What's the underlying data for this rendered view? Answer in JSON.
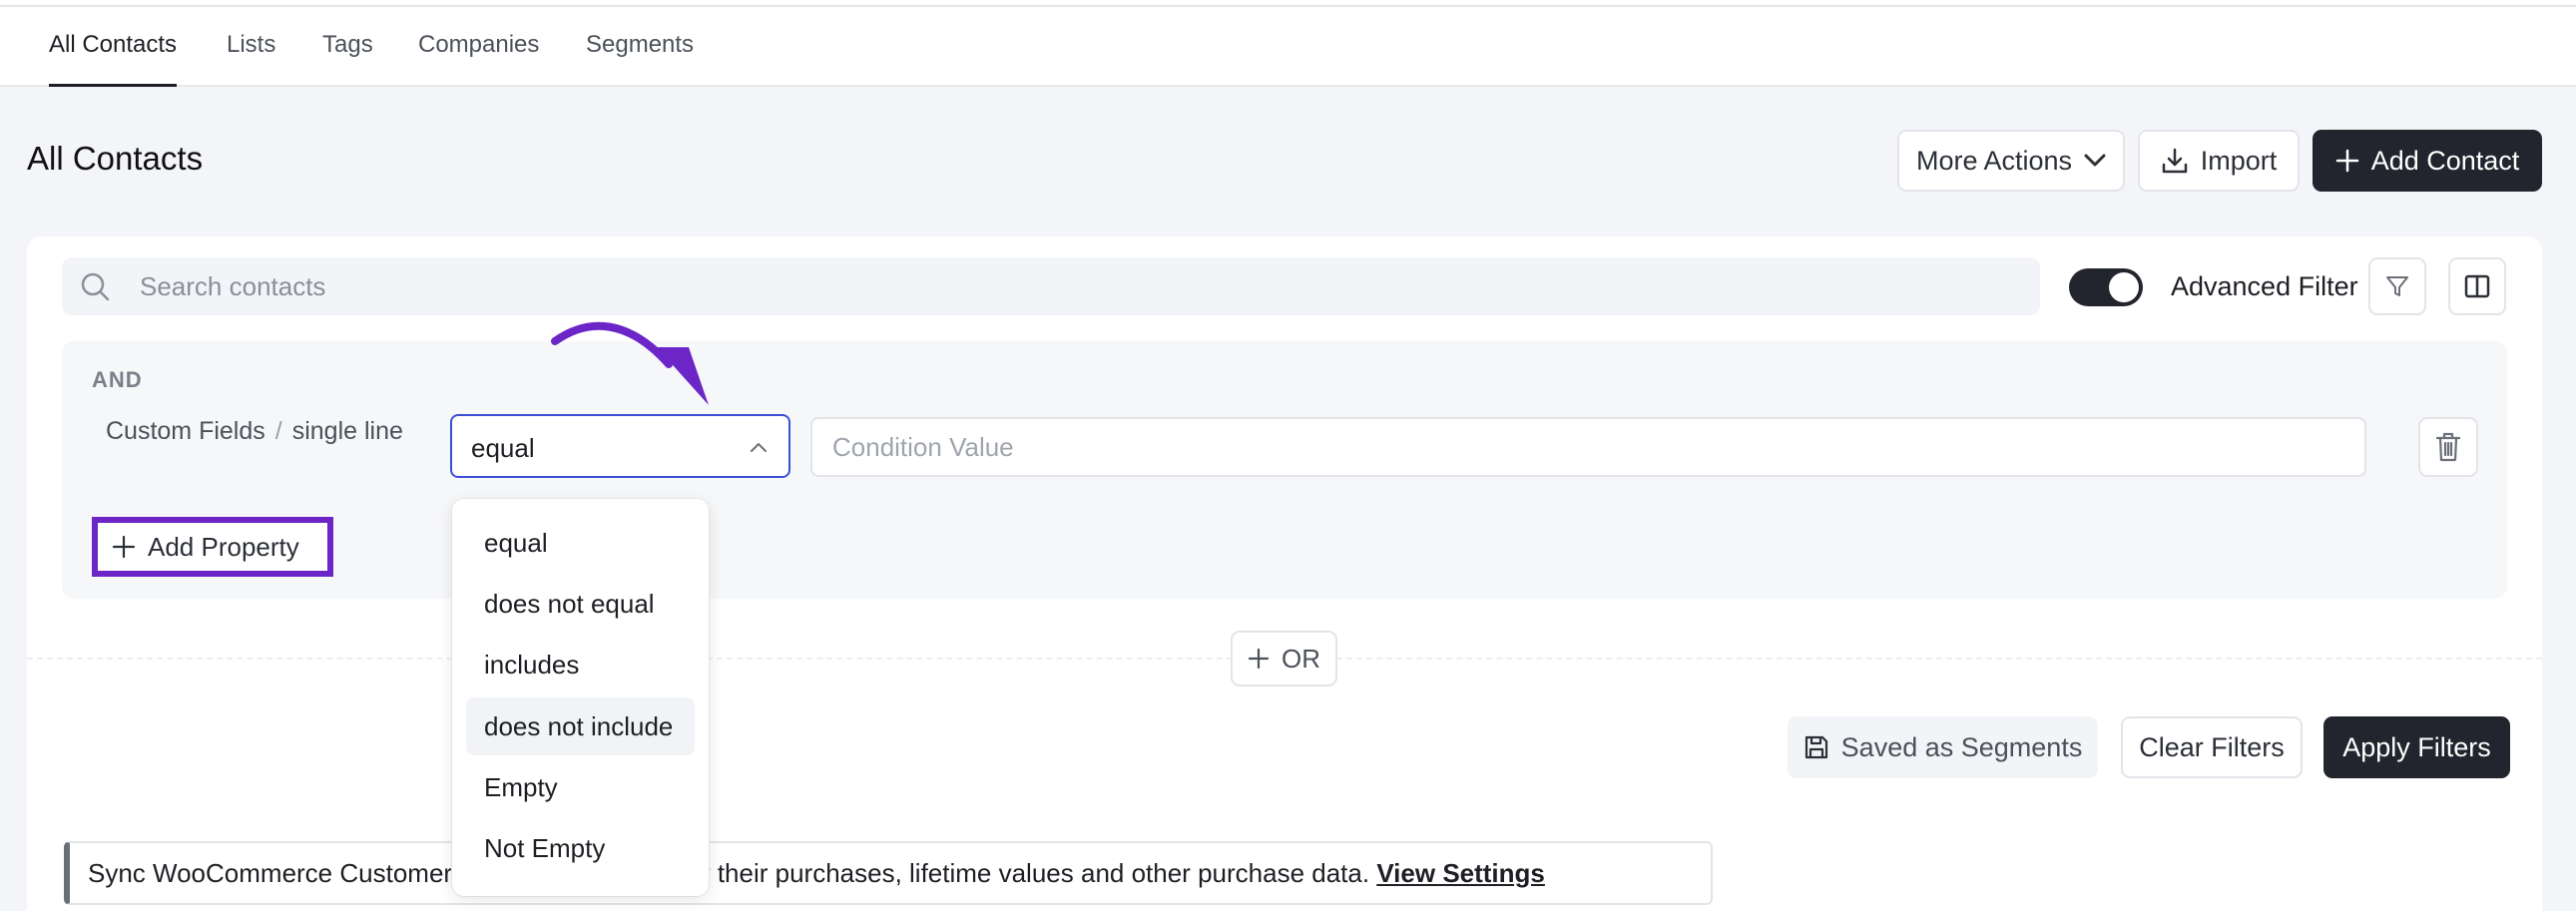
{
  "tabs": [
    {
      "label": "All Contacts",
      "active": true
    },
    {
      "label": "Lists"
    },
    {
      "label": "Tags"
    },
    {
      "label": "Companies"
    },
    {
      "label": "Segments"
    }
  ],
  "page_title": "All Contacts",
  "header_actions": {
    "more_actions": "More Actions",
    "import": "Import",
    "add_contact": "Add Contact"
  },
  "search": {
    "placeholder": "Search contacts"
  },
  "advanced_filter": {
    "label": "Advanced Filter",
    "enabled": true
  },
  "filter_group": {
    "operator_label": "AND",
    "field_group": "Custom Fields",
    "field_separator": "/",
    "field_name": "single line",
    "selected_condition": "equal",
    "value_placeholder": "Condition Value",
    "add_property": "Add Property",
    "or_label": "OR"
  },
  "condition_options": [
    {
      "label": "equal"
    },
    {
      "label": "does not equal"
    },
    {
      "label": "includes"
    },
    {
      "label": "does not include",
      "highlighted": true
    },
    {
      "label": "Empty"
    },
    {
      "label": "Not Empty"
    }
  ],
  "filter_actions": {
    "save_segment": "Saved as Segments",
    "clear": "Clear Filters",
    "apply": "Apply Filters"
  },
  "banner": {
    "text_start": "Sync WooCommerce Customers",
    "text_end": "ment them by their purchases, lifetime values and other purchase data.",
    "link": "View Settings"
  },
  "colors": {
    "primary_dark": "#22252d",
    "annotation_purple": "#6c25c7",
    "select_focus": "#3b4fd6"
  }
}
